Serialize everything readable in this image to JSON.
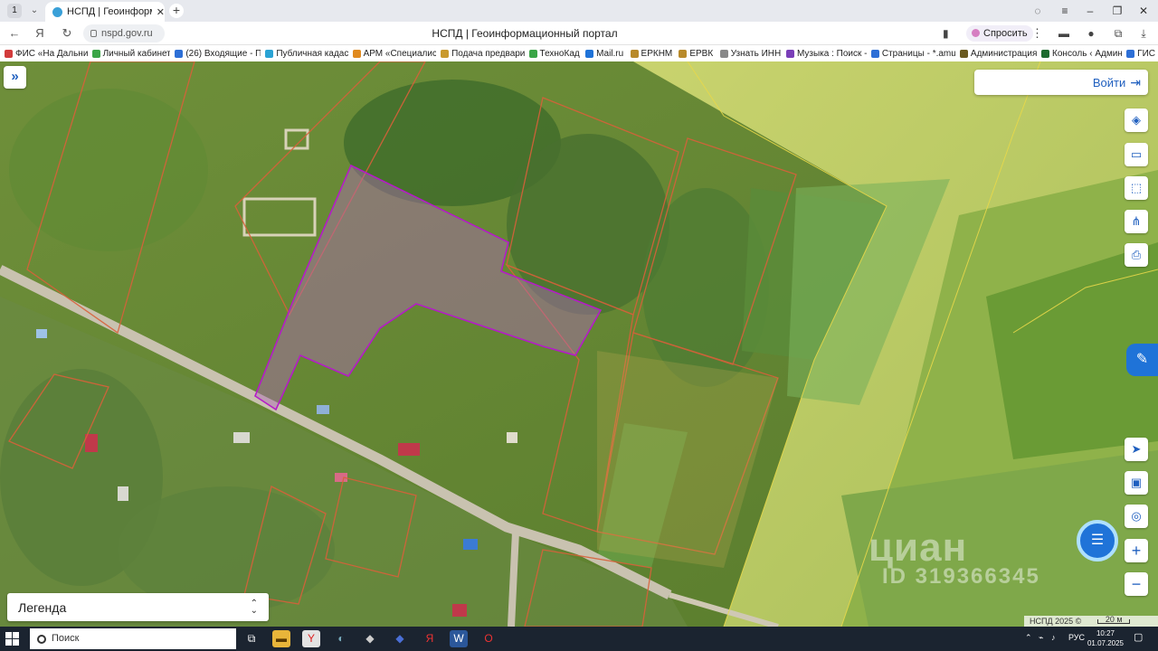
{
  "browser": {
    "tab_counter": "1",
    "tab_title": "НСПД | Геоинформаци",
    "url": "nspd.gov.ru",
    "page_title": "НСПД | Геоинформационный портал",
    "ask_label": "Спросить"
  },
  "bookmarks": [
    {
      "label": "ФИС «На Дальни",
      "color": "#d23b3b"
    },
    {
      "label": "Личный кабинет",
      "color": "#3aa546"
    },
    {
      "label": "(26) Входящие - П",
      "color": "#2d6fd6"
    },
    {
      "label": "Публичная кадас",
      "color": "#2aa3d4"
    },
    {
      "label": "АРМ «Специалис",
      "color": "#e08a1e"
    },
    {
      "label": "Подача предвари",
      "color": "#c99a2e"
    },
    {
      "label": "ТехноКад",
      "color": "#3aa546"
    },
    {
      "label": "Mail.ru",
      "color": "#1f73d8"
    },
    {
      "label": "ЕРКНМ",
      "color": "#b88a2a"
    },
    {
      "label": "ЕРВК",
      "color": "#b88a2a"
    },
    {
      "label": "Узнать ИНН",
      "color": "#888888"
    },
    {
      "label": "Музыка : Поиск -",
      "color": "#7a3fb8"
    },
    {
      "label": "Страницы - *.amu",
      "color": "#2d6fd6"
    },
    {
      "label": "Администрация",
      "color": "#6a5a20"
    },
    {
      "label": "Консоль ‹ Админ",
      "color": "#1d6a2e"
    },
    {
      "label": "ГИС",
      "color": "#2d6fd6"
    }
  ],
  "map": {
    "login_label": "Войти",
    "legend_label": "Легенда",
    "attribution": "НСПД 2025 ©",
    "scale_label": "20 м",
    "watermark": "циан",
    "watermark_id": "ID 319366345"
  },
  "taskbar": {
    "search_placeholder": "Поиск",
    "lang": "РУС",
    "time": "10:27",
    "date": "01.07.2025"
  }
}
